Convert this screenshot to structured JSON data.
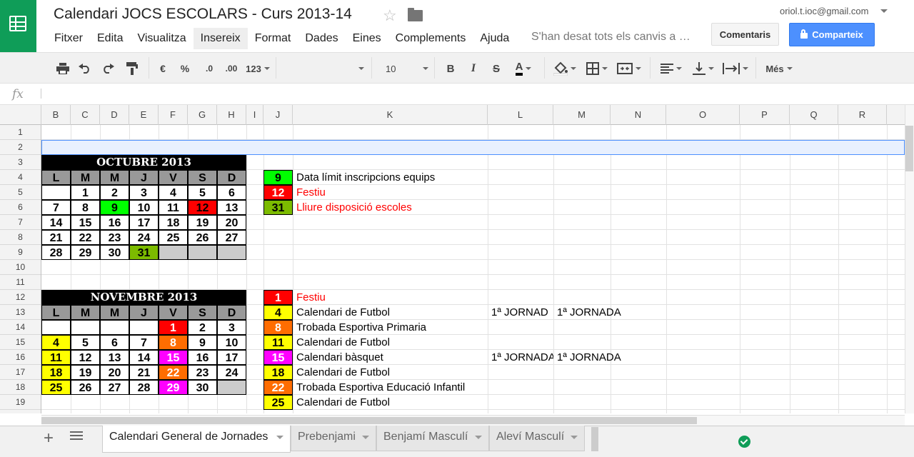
{
  "doc": {
    "title": "Calendari JOCS ESCOLARS - Curs 2013-14",
    "account": "oriol.t.ioc@gmail.com",
    "saved": "S'han desat tots els canvis a …"
  },
  "menu": [
    "Fitxer",
    "Edita",
    "Visualitza",
    "Insereix",
    "Format",
    "Dades",
    "Eines",
    "Complements",
    "Ajuda"
  ],
  "buttons": {
    "comments": "Comentaris",
    "share": "Comparteix"
  },
  "toolbar": {
    "currency": "€",
    "percent": "%",
    "dec_less": ".0",
    "dec_more": ".00",
    "format": "123",
    "font_size": "10",
    "bold": "B",
    "italic": "I",
    "strike": "S",
    "text_color": "A",
    "more": "Més"
  },
  "formula": {
    "fx": "fx",
    "value": ""
  },
  "columns": [
    "B",
    "C",
    "D",
    "E",
    "F",
    "G",
    "H",
    "I",
    "J",
    "K",
    "L",
    "M",
    "N",
    "O",
    "P",
    "Q",
    "R"
  ],
  "rows": [
    "1",
    "2",
    "3",
    "4",
    "5",
    "6",
    "7",
    "8",
    "9",
    "10",
    "11",
    "12",
    "13",
    "14",
    "15",
    "16",
    "17",
    "18",
    "19"
  ],
  "calendar": {
    "weekdays": [
      "L",
      "M",
      "M",
      "J",
      "V",
      "S",
      "D"
    ],
    "oct_title": "OCTUBRE 2013",
    "oct": [
      [
        "",
        "1",
        "2",
        "3",
        "4",
        "5",
        "6"
      ],
      [
        "7",
        "8",
        "9",
        "10",
        "11",
        "12",
        "13"
      ],
      [
        "14",
        "15",
        "16",
        "17",
        "18",
        "19",
        "20"
      ],
      [
        "21",
        "22",
        "23",
        "24",
        "25",
        "26",
        "27"
      ],
      [
        "28",
        "29",
        "30",
        "31",
        "",
        "",
        ""
      ]
    ],
    "nov_title": "NOVEMBRE 2013",
    "nov": [
      [
        "",
        "",
        "",
        "",
        "1",
        "2",
        "3"
      ],
      [
        "4",
        "5",
        "6",
        "7",
        "8",
        "9",
        "10"
      ],
      [
        "11",
        "12",
        "13",
        "14",
        "15",
        "16",
        "17"
      ],
      [
        "18",
        "19",
        "20",
        "21",
        "22",
        "23",
        "24"
      ],
      [
        "25",
        "26",
        "27",
        "28",
        "29",
        "30",
        ""
      ]
    ]
  },
  "legend_oct": [
    {
      "num": "9",
      "text": "Data límit inscripcions equips",
      "color": "#00ff00",
      "text_color": "#000000"
    },
    {
      "num": "12",
      "text": "Festiu",
      "color": "#ff0000",
      "text_color": "#ff0000"
    },
    {
      "num": "31",
      "text": "Lliure disposició escoles",
      "color": "#7cbb00",
      "text_color": "#ff0000"
    }
  ],
  "legend_nov": [
    {
      "num": "1",
      "text": "Festiu",
      "color": "#ff0000",
      "text_color": "#ff0000"
    },
    {
      "num": "4",
      "text": "Calendari de Futbol",
      "color": "#ffff00",
      "text_color": "#000000"
    },
    {
      "num": "8",
      "text": "Trobada Esportiva Primaria",
      "color": "#ff6d01",
      "text_color": "#000000"
    },
    {
      "num": "11",
      "text": "Calendari de Futbol",
      "color": "#ffff00",
      "text_color": "#000000"
    },
    {
      "num": "15",
      "text": "Calendari bàsquet",
      "color": "#ff00ff",
      "text_color": "#000000"
    },
    {
      "num": "18",
      "text": "Calendari de Futbol",
      "color": "#ffff00",
      "text_color": "#000000"
    },
    {
      "num": "22",
      "text": "Trobada Esportiva Educació Infantil",
      "color": "#ff6d01",
      "text_color": "#000000"
    },
    {
      "num": "25",
      "text": "Calendari de Futbol",
      "color": "#ffff00",
      "text_color": "#000000"
    }
  ],
  "jornada": {
    "l13": "1ª JORNAD",
    "m13": "1ª JORNADA",
    "l16": "1ª JORNADA",
    "m16": "1ª JORNADA"
  },
  "tabs": [
    "Calendari General de Jornades",
    "Prebenjami",
    "Benjamí Masculí",
    "Aleví Masculí"
  ]
}
